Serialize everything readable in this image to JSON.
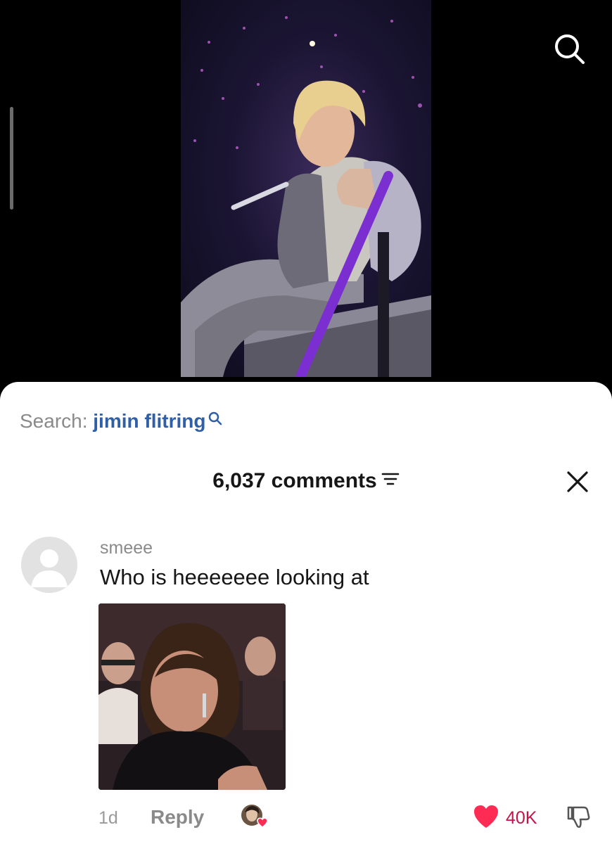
{
  "video": {
    "scene": "concert-performer-image",
    "search_icon": "search-icon"
  },
  "search_bar": {
    "prefix": "Search:",
    "term": "jimin flitring",
    "icon": "search-mini-icon"
  },
  "comments_panel": {
    "count_label": "6,037 comments",
    "filter_icon": "filter-icon",
    "close_icon": "close-icon"
  },
  "comment": {
    "username": "smeee",
    "text": "Who is heeeeeee looking at",
    "image": "reaction-image",
    "timestamp": "1d",
    "reply_label": "Reply",
    "like_count": "40K",
    "colors": {
      "like": "#fe2c55",
      "link": "#2f5fa7"
    }
  }
}
